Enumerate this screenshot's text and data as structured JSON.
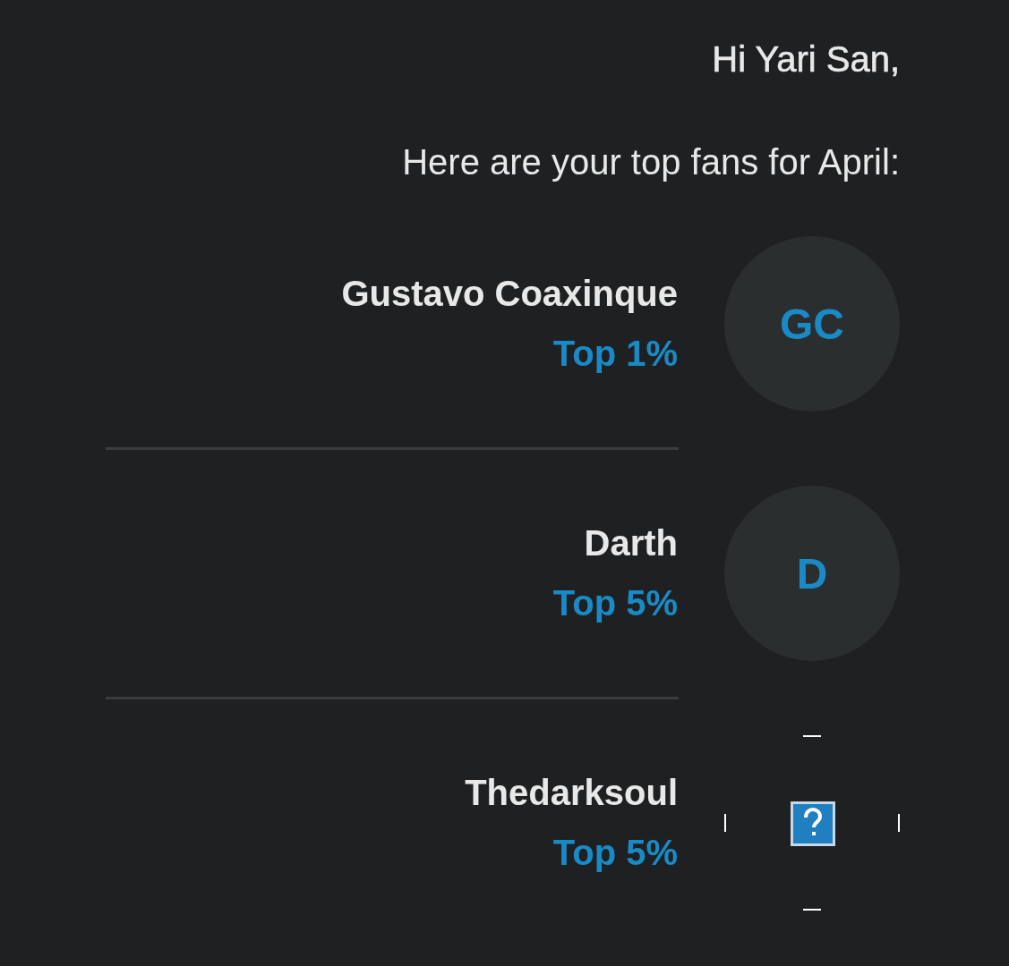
{
  "greeting": "Hi Yari San,",
  "intro": "Here are your top fans for April:",
  "fans": [
    {
      "kind": "initials",
      "initials": "GC",
      "name": "Gustavo Coaxinque",
      "rank": "Top 1%"
    },
    {
      "kind": "initials",
      "initials": "D",
      "name": "Darth",
      "rank": "Top 5%"
    },
    {
      "kind": "image",
      "name": "Thedarksoul",
      "rank": "Top 5%"
    }
  ]
}
